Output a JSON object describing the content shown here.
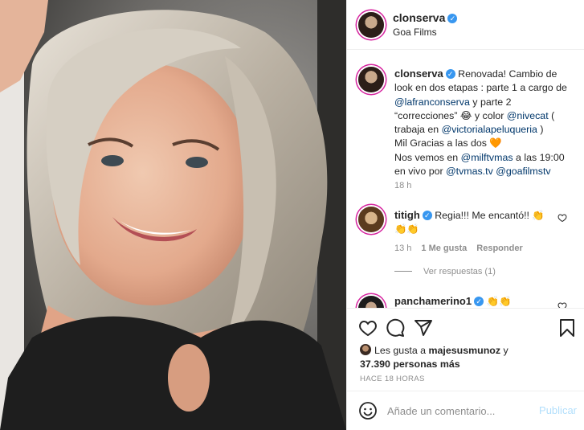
{
  "post": {
    "author": "clonserva",
    "location": "Goa Films",
    "verified_icon": "verified-badge-icon"
  },
  "caption": {
    "author": "clonserva",
    "segments": [
      {
        "text": " Renovada! Cambio de look en dos etapas : parte 1 a cargo de ",
        "type": "text"
      },
      {
        "text": "@lafranconserva",
        "type": "mention"
      },
      {
        "text": " y parte 2 “correcciones” 😂 y color ",
        "type": "text"
      },
      {
        "text": "@nivecat",
        "type": "mention"
      },
      {
        "text": " ( trabaja en ",
        "type": "text"
      },
      {
        "text": "@victorialapeluqueria",
        "type": "mention"
      },
      {
        "text": " )",
        "type": "text"
      },
      {
        "text": "Mil Gracias a las dos 🧡",
        "type": "line"
      },
      {
        "text": "Nos vemos en ",
        "type": "line-start"
      },
      {
        "text": "@milftvmas",
        "type": "mention"
      },
      {
        "text": " a las 19:00 en vivo por ",
        "type": "text"
      },
      {
        "text": "@tvmas.tv",
        "type": "mention"
      },
      {
        "text": " ",
        "type": "text"
      },
      {
        "text": "@goafilmstv",
        "type": "mention"
      }
    ],
    "time": "18 h"
  },
  "comments": [
    {
      "author": "titigh",
      "text": " Regia!!! Me encantó!! 👏👏👏",
      "time": "13 h",
      "likes": "1 Me gusta",
      "reply_label": "Responder",
      "view_replies": "Ver respuestas (1)"
    },
    {
      "author": "panchamerino1",
      "text": " 👏👏"
    }
  ],
  "actions": {
    "like_icon": "heart-icon",
    "comment_icon": "comment-icon",
    "share_icon": "share-icon",
    "save_icon": "bookmark-icon"
  },
  "likes": {
    "prefix": "Les gusta a ",
    "user": "majesusmunoz",
    "suffix": " y",
    "count_text": "37.390 personas más"
  },
  "posted_ago": "HACE 18 HORAS",
  "add_comment": {
    "placeholder": "Añade un comentario...",
    "publish_label": "Publicar"
  },
  "colors": {
    "accent": "#3897f0",
    "mention": "#00376b",
    "muted": "#8e8e8e",
    "publish_disabled": "#b2dffc"
  }
}
